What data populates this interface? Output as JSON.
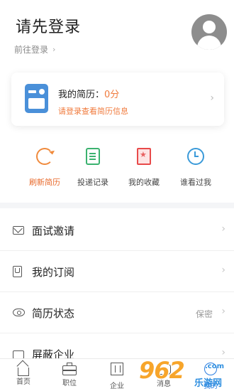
{
  "header": {
    "title": "请先登录",
    "login_link": "前往登录"
  },
  "resume_card": {
    "label": "我的简历：",
    "score": "0分",
    "hint": "请登录查看简历信息"
  },
  "actions": [
    {
      "label": "刷新简历",
      "icon": "refresh-icon",
      "active": true
    },
    {
      "label": "投递记录",
      "icon": "document-icon"
    },
    {
      "label": "我的收藏",
      "icon": "favorite-icon"
    },
    {
      "label": "谁看过我",
      "icon": "clock-icon"
    }
  ],
  "menu": [
    {
      "label": "面试邀请",
      "icon": "mail-icon",
      "value": ""
    },
    {
      "label": "我的订阅",
      "icon": "bookmark-icon",
      "value": ""
    },
    {
      "label": "简历状态",
      "icon": "eye-icon",
      "value": "保密"
    },
    {
      "label": "屏蔽企业",
      "icon": "block-icon",
      "value": ""
    }
  ],
  "bottom_nav": [
    {
      "label": "首页",
      "icon": "home-icon"
    },
    {
      "label": "职位",
      "icon": "briefcase-icon"
    },
    {
      "label": "企业",
      "icon": "building-icon"
    },
    {
      "label": "消息",
      "icon": "message-icon"
    },
    {
      "label": "我的",
      "icon": "profile-icon",
      "active": true
    }
  ],
  "watermark": {
    "number": "962",
    "suffix": ".com",
    "site": "乐游网"
  },
  "colors": {
    "accent_orange": "#f07a3c",
    "active_blue": "#2a7de1",
    "resume_icon_blue": "#4a90d9"
  }
}
